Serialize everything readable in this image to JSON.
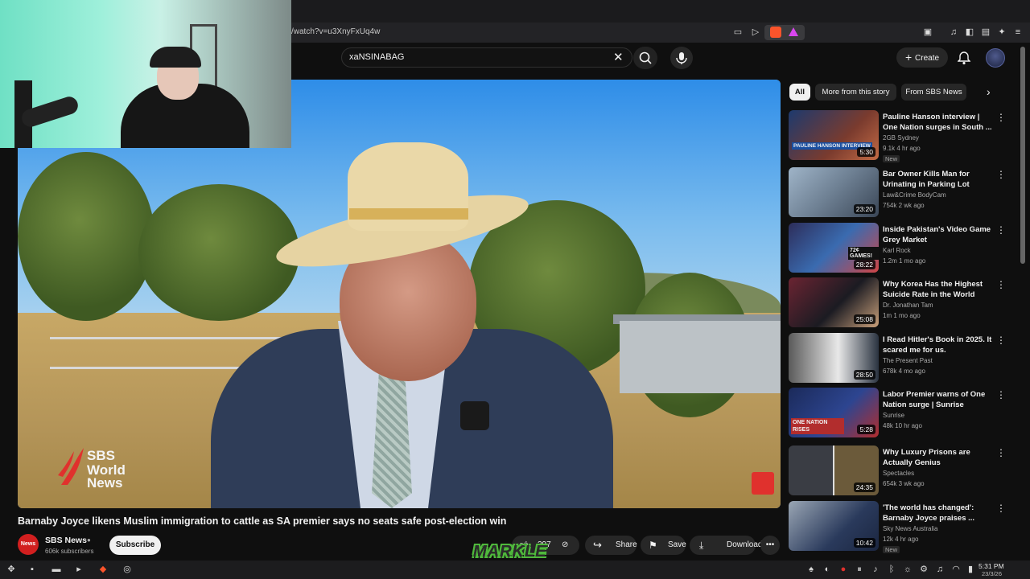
{
  "browser": {
    "url": "/watch?v=u3XnyFxUq4w"
  },
  "header": {
    "search_value": "xaNSINABAG",
    "create_label": "Create"
  },
  "video": {
    "title": "Barnaby Joyce likens Muslim immigration to cattle as SA premier says no seats safe post-election win",
    "watermark_lines": [
      "SBS",
      "World",
      "News"
    ]
  },
  "channel": {
    "avatar_text": "News",
    "name": "SBS News",
    "subscribers": "606k subscribers",
    "subscribe_label": "Subscribe"
  },
  "actions": {
    "like_count": "297",
    "share_label": "Share",
    "save_label": "Save",
    "download_label": "Download"
  },
  "overlay_sticker": "MARKLE",
  "chips": [
    "All",
    "More from this story",
    "From SBS News"
  ],
  "recommendations": [
    {
      "title": "Pauline Hanson interview | One Nation surges in South ...",
      "channel": "2GB Sydney",
      "meta": "9.1k  4 hr ago",
      "duration": "5:30",
      "badge": "New",
      "thumb_text": "PAULINE HANSON INTERVIEW"
    },
    {
      "title": "Bar Owner Kills Man for Urinating in Parking Lot",
      "channel": "Law&Crime BodyCam",
      "meta": "754k  2 wk ago",
      "duration": "23:20"
    },
    {
      "title": "Inside Pakistan's Video Game Grey Market",
      "channel": "Karl Rock",
      "meta": "1.2m  1 mo ago",
      "duration": "28:22",
      "thumb_text": "72¢ GAMES!"
    },
    {
      "title": "Why Korea Has the Highest Suicide Rate in the World",
      "channel": "Dr. Jonathan Tam",
      "meta": "1m  1 mo ago",
      "duration": "25:08"
    },
    {
      "title": "I Read Hitler's Book in 2025. It scared me for us.",
      "channel": "The Present Past",
      "meta": "678k  4 mo ago",
      "duration": "28:50"
    },
    {
      "title": "Labor Premier warns of One Nation surge | Sunrise",
      "channel": "Sunrise",
      "meta": "48k  10 hr ago",
      "duration": "5:28",
      "thumb_text": "ONE NATION RISES"
    },
    {
      "title": "Why Luxury Prisons are Actually Genius",
      "channel": "Spectacles",
      "meta": "654k  3 wk ago",
      "duration": "24:35"
    },
    {
      "title": "'The world has changed': Barnaby Joyce praises ...",
      "channel": "Sky News Australia",
      "meta": "12k  4 hr ago",
      "duration": "10:42",
      "badge": "New"
    }
  ],
  "tray": {
    "time": "5:31 PM",
    "date": "23/3/26"
  },
  "colors": {
    "background": "#0f0f0f",
    "accent_red": "#d21f1f",
    "sticker_green": "#4fb83c"
  }
}
